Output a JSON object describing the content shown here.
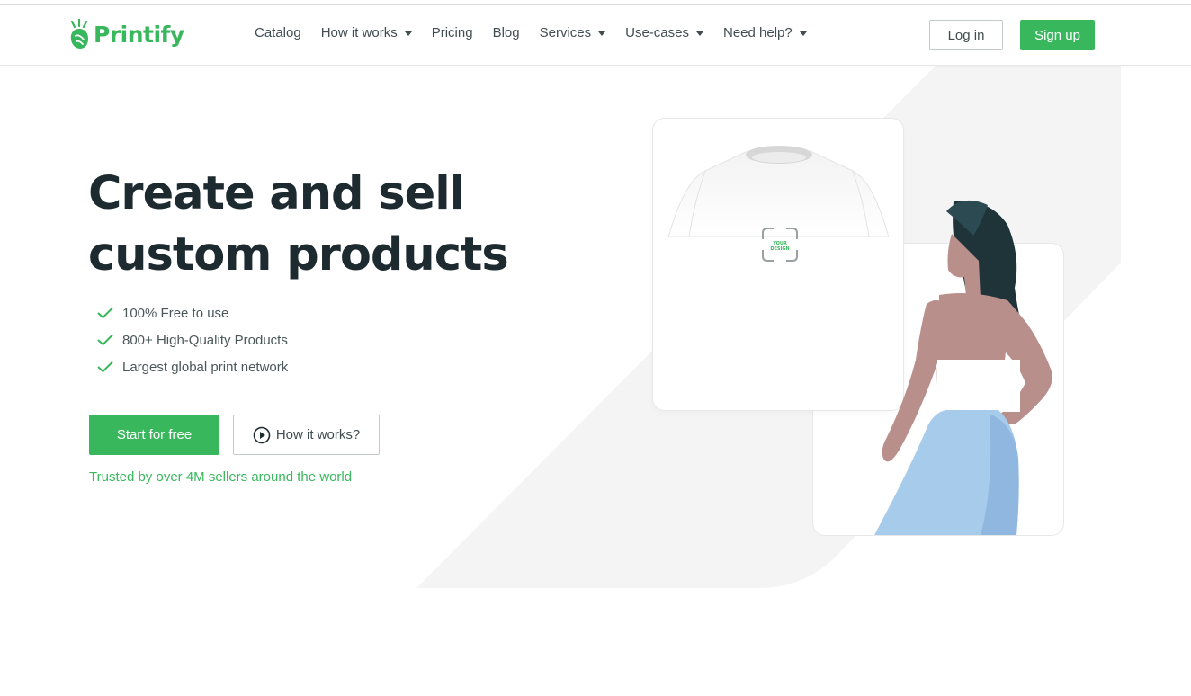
{
  "brand": {
    "name": "Printify",
    "color": "#39b75d"
  },
  "nav": {
    "items": [
      {
        "label": "Catalog",
        "dropdown": false
      },
      {
        "label": "How it works",
        "dropdown": true
      },
      {
        "label": "Pricing",
        "dropdown": false
      },
      {
        "label": "Blog",
        "dropdown": false
      },
      {
        "label": "Services",
        "dropdown": true
      },
      {
        "label": "Use-cases",
        "dropdown": true
      },
      {
        "label": "Need help?",
        "dropdown": true
      }
    ],
    "login_label": "Log in",
    "signup_label": "Sign up"
  },
  "hero": {
    "title_line1": "Create and sell",
    "title_line2": "custom products",
    "features": [
      "100% Free to use",
      "800+ High-Quality Products",
      "Largest global print network"
    ],
    "start_label": "Start for free",
    "how_label": "How it works?",
    "trusted_text": "Trusted by over 4M sellers around the world"
  },
  "illustration": {
    "design_placeholder_line1": "YOUR",
    "design_placeholder_line2": "DESIGN",
    "icons": [
      "t-shirt-image",
      "woman-illustration",
      "design-frame-icon"
    ]
  },
  "colors": {
    "accent": "#39b75d",
    "text_dark": "#1d2a2f",
    "text_muted": "#4b5659",
    "skirt": "#a7cbea",
    "skin": "#b98f8c",
    "hair": "#1f3439"
  }
}
